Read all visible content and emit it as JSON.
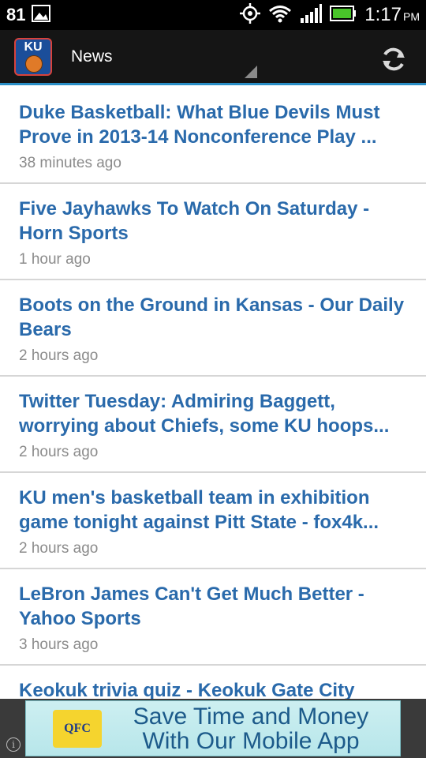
{
  "status_bar": {
    "notification_count": "81",
    "time": "1:17",
    "ampm": "PM",
    "icons": [
      "image-icon",
      "gps-icon",
      "wifi-icon",
      "signal-icon",
      "battery-icon"
    ]
  },
  "app_bar": {
    "logo_text": "KU",
    "title": "News",
    "refresh_icon": "refresh-icon"
  },
  "news": [
    {
      "title": "Duke Basketball: What Blue Devils Must Prove in 2013-14 Nonconference Play ...",
      "time": "38 minutes ago"
    },
    {
      "title": "Five Jayhawks To Watch On Saturday - Horn Sports",
      "time": "1 hour ago"
    },
    {
      "title": "Boots on the Ground in Kansas - Our Daily Bears",
      "time": "2 hours ago"
    },
    {
      "title": "Twitter Tuesday: Admiring Baggett, worrying about Chiefs, some KU hoops...",
      "time": "2 hours ago"
    },
    {
      "title": "KU men's basketball team in exhibition game tonight against Pitt State - fox4k...",
      "time": "2 hours ago"
    },
    {
      "title": "LeBron James Can't Get Much Better - Yahoo Sports",
      "time": "3 hours ago"
    },
    {
      "title": "Keokuk trivia quiz - Keokuk Gate City",
      "time": ""
    }
  ],
  "ad": {
    "logo_text": "QFC",
    "text": "Save Time and Money\nWith Our Mobile App",
    "info_icon": "i"
  },
  "colors": {
    "headline": "#2a6aab",
    "timestamp": "#8b8b8b",
    "accent": "#2a8ec6"
  }
}
